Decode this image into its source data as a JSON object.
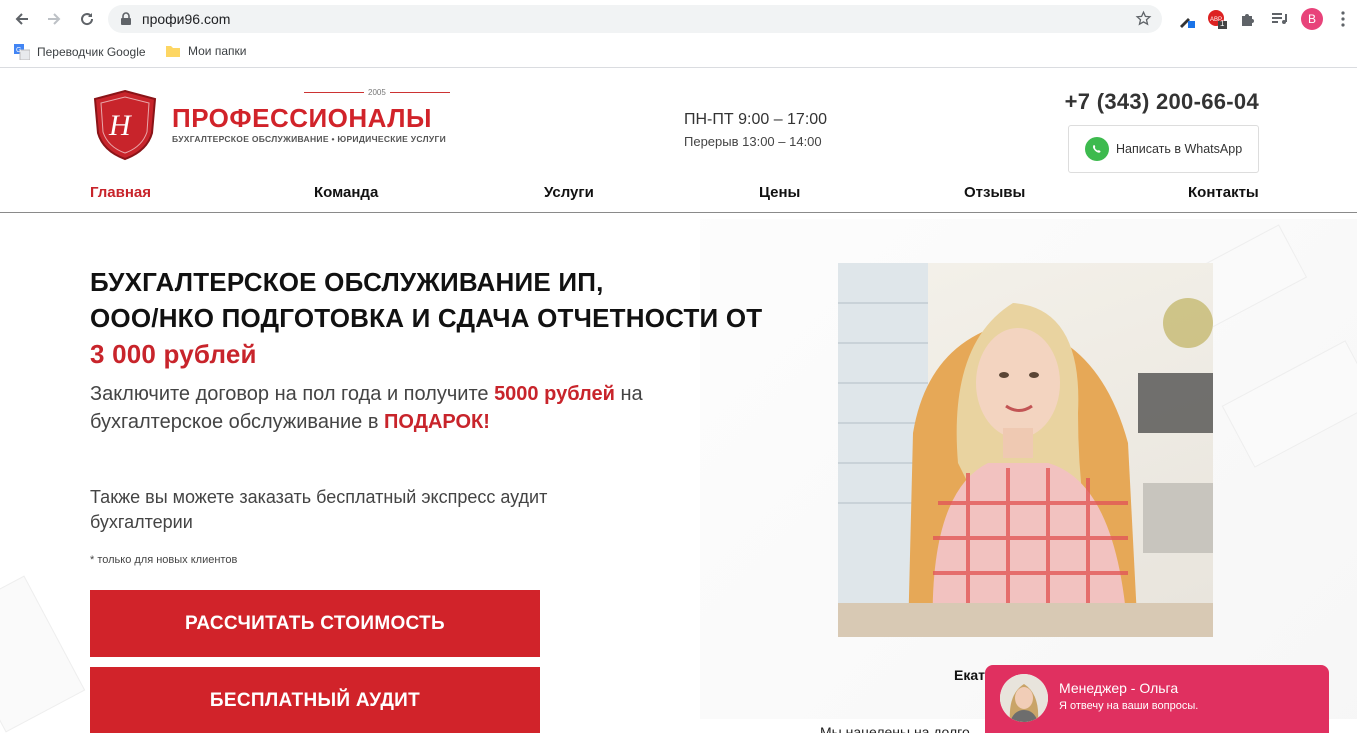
{
  "browser": {
    "url": "профи96.com",
    "bookmarks": [
      {
        "label": "Переводчик Google",
        "icon": "google-translate-icon"
      },
      {
        "label": "Мои папки",
        "icon": "folder-icon"
      }
    ],
    "profile_initial": "B",
    "extension_badge": "1"
  },
  "header": {
    "brand_name": "ПРОФЕССИОНАЛЫ",
    "brand_year": "2005",
    "brand_tagline": "БУХГАЛТЕРСКОЕ ОБСЛУЖИВАНИЕ • ЮРИДИЧЕСКИЕ УСЛУГИ",
    "hours": "ПН-ПТ 9:00 – 17:00",
    "break": "Перерыв 13:00 – 14:00",
    "phone": "+7 (343) 200-66-04",
    "whatsapp_label": "Написать в WhatsApp"
  },
  "menu": [
    {
      "label": "Главная",
      "active": true
    },
    {
      "label": "Команда"
    },
    {
      "label": "Услуги"
    },
    {
      "label": "Цены"
    },
    {
      "label": "Отзывы"
    },
    {
      "label": "Контакты"
    }
  ],
  "hero": {
    "title_line1": "БУХГАЛТЕРСКОЕ ОБСЛУЖИВАНИЕ ИП,",
    "title_line2": "ООО/НКО ПОДГОТОВКА И СДАЧА ОТЧЕТНОСТИ ОТ",
    "title_price": "3 000 рублей",
    "sub_part1": "Заключите договор на пол года и получите ",
    "sub_bold1": "5000 рублей",
    "sub_part2": " на бухгалтерское обслуживание в ",
    "sub_bold2": "ПОДАРОК!",
    "audit_text": "Также вы можете заказать бесплатный экспресс аудит бухгалтерии",
    "note": "* только для новых клиентов",
    "cta_calc": "РАССЧИТАТЬ СТОИМОСТЬ",
    "cta_audit": "БЕСПЛАТНЫЙ АУДИТ",
    "photo_caption": "Екат",
    "photo_caption2": "Мы нацелены на долго"
  },
  "chat": {
    "name": "Менеджер - Ольга",
    "message": "Я отвечу на ваши вопросы."
  },
  "colors": {
    "brand_red": "#d1232a",
    "chat_pink": "#e03060",
    "whatsapp_green": "#3dba4e"
  }
}
